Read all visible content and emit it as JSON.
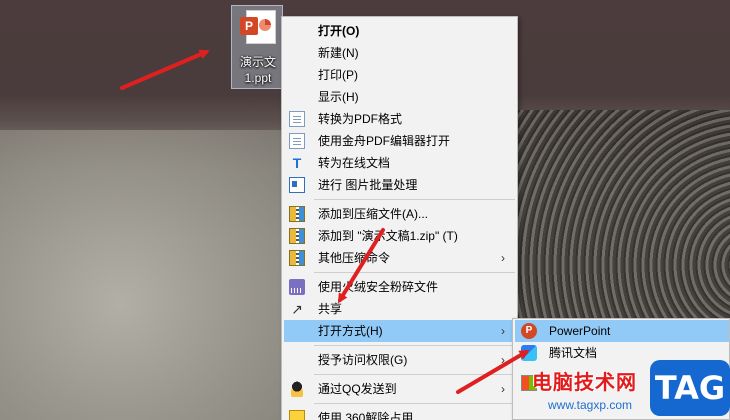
{
  "desktop_file": {
    "label_line1": "演示文",
    "label_line2": "1.ppt",
    "icon": "powerpoint-file-icon"
  },
  "context_menu": {
    "items": [
      {
        "label": "打开(O)",
        "icon": "",
        "submenu": false
      },
      {
        "label": "新建(N)",
        "icon": "",
        "submenu": false
      },
      {
        "label": "打印(P)",
        "icon": "",
        "submenu": false
      },
      {
        "label": "显示(H)",
        "icon": "",
        "submenu": false
      },
      {
        "label": "转换为PDF格式",
        "icon": "document-icon",
        "submenu": false
      },
      {
        "label": "使用金舟PDF编辑器打开",
        "icon": "pdf-editor-icon",
        "submenu": false
      },
      {
        "label": "转为在线文档",
        "icon": "tencent-docs-icon",
        "submenu": false
      },
      {
        "label": "进行 图片批量处理",
        "icon": "image-batch-icon",
        "submenu": false
      },
      {
        "label": "添加到压缩文件(A)...",
        "icon": "archive-icon",
        "submenu": false
      },
      {
        "label": "添加到 \"演示文稿1.zip\" (T)",
        "icon": "archive-icon",
        "submenu": false
      },
      {
        "label": "其他压缩命令",
        "icon": "archive-icon",
        "submenu": true
      },
      {
        "label": "使用火绒安全粉碎文件",
        "icon": "shredder-icon",
        "submenu": false
      },
      {
        "label": "共享",
        "icon": "share-icon",
        "submenu": false
      },
      {
        "label": "打开方式(H)",
        "icon": "",
        "submenu": true
      },
      {
        "label": "授予访问权限(G)",
        "icon": "",
        "submenu": true
      },
      {
        "label": "通过QQ发送到",
        "icon": "qq-icon",
        "submenu": true
      },
      {
        "label": "使用 360解除占用",
        "icon": "360-icon",
        "submenu": false
      }
    ]
  },
  "open_with_submenu": {
    "items": [
      {
        "label": "PowerPoint",
        "icon": "powerpoint-icon"
      },
      {
        "label": "腾讯文档",
        "icon": "tencent-docs-icon"
      },
      {
        "label": "",
        "icon": "app-icon"
      }
    ]
  },
  "watermark": {
    "text": "电脑技术网",
    "url": "www.tagxp.com",
    "badge": "TAG"
  },
  "colors": {
    "highlight": "#91c9f7",
    "arrow": "#e02020",
    "menu_bg": "#f2f2f2"
  }
}
